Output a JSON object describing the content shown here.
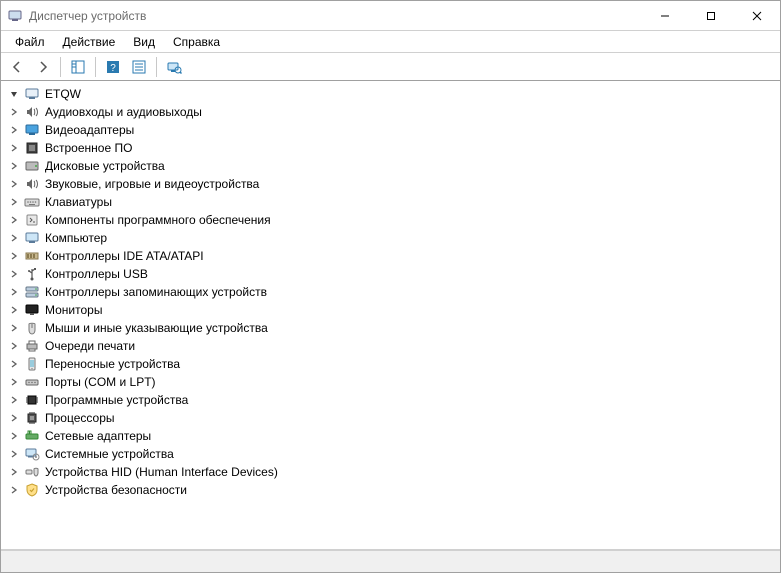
{
  "window": {
    "title": "Диспетчер устройств"
  },
  "menu": {
    "file": "Файл",
    "action": "Действие",
    "view": "Вид",
    "help": "Справка"
  },
  "tree": {
    "root": "ETQW",
    "categories": [
      {
        "icon": "audio",
        "label": "Аудиовходы и аудиовыходы"
      },
      {
        "icon": "display",
        "label": "Видеоадаптеры"
      },
      {
        "icon": "firmware",
        "label": "Встроенное ПО"
      },
      {
        "icon": "disk",
        "label": "Дисковые устройства"
      },
      {
        "icon": "audio",
        "label": "Звуковые, игровые и видеоустройства"
      },
      {
        "icon": "keyboard",
        "label": "Клавиатуры"
      },
      {
        "icon": "software",
        "label": "Компоненты программного обеспечения"
      },
      {
        "icon": "computer",
        "label": "Компьютер"
      },
      {
        "icon": "ide",
        "label": "Контроллеры IDE ATA/ATAPI"
      },
      {
        "icon": "usb",
        "label": "Контроллеры USB"
      },
      {
        "icon": "storage",
        "label": "Контроллеры запоминающих устройств"
      },
      {
        "icon": "monitor",
        "label": "Мониторы"
      },
      {
        "icon": "mouse",
        "label": "Мыши и иные указывающие устройства"
      },
      {
        "icon": "printqueue",
        "label": "Очереди печати"
      },
      {
        "icon": "portable",
        "label": "Переносные устройства"
      },
      {
        "icon": "port",
        "label": "Порты (COM и LPT)"
      },
      {
        "icon": "chip",
        "label": "Программные устройства"
      },
      {
        "icon": "cpu",
        "label": "Процессоры"
      },
      {
        "icon": "network",
        "label": "Сетевые адаптеры"
      },
      {
        "icon": "system",
        "label": "Системные устройства"
      },
      {
        "icon": "hid",
        "label": "Устройства HID (Human Interface Devices)"
      },
      {
        "icon": "security",
        "label": "Устройства безопасности"
      }
    ]
  }
}
